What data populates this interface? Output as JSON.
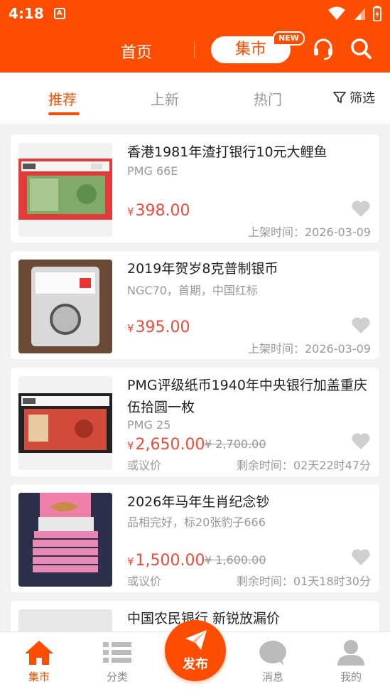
{
  "status": {
    "time": "4:18",
    "notification_glyph": "A"
  },
  "header": {
    "home_label": "首页",
    "market_label": "集市",
    "new_badge": "NEW"
  },
  "tabs": {
    "items": [
      "推荐",
      "上新",
      "热门"
    ],
    "active": "推荐",
    "filter_label": "筛选"
  },
  "listings": [
    {
      "title": "香港1981年渣打银行10元大鲤鱼",
      "subtitle": "PMG 66E",
      "currency": "¥",
      "price": "398.00",
      "meta": "上架时间：2026-03-09"
    },
    {
      "title": "2019年贺岁8克普制银币",
      "subtitle": "NGC70，首期，中国红标",
      "currency": "¥",
      "price": "395.00",
      "meta": "上架时间：2026-03-09"
    },
    {
      "title": "PMG评级纸币1940年中央银行加盖重庆伍拾圆一枚",
      "subtitle": "PMG 25",
      "currency": "¥",
      "price": "2,650.00",
      "old_price": "¥ 2,700.00",
      "negotiable": "或议价",
      "meta": "剩余时间：02天22时47分"
    },
    {
      "title": "2026年马年生肖纪念钞",
      "subtitle": "品相完好，标20张豹子666",
      "currency": "¥",
      "price": "1,500.00",
      "old_price": "¥ 1,600.00",
      "negotiable": "或议价",
      "meta": "剩余时间：01天18时30分"
    },
    {
      "title": "中国农民银行 新锐放漏价"
    }
  ],
  "tabbar": {
    "market": "集市",
    "category": "分类",
    "publish": "发布",
    "messages": "消息",
    "mine": "我的"
  },
  "colors": {
    "brand": "#ff4d00",
    "price": "#f04a3a"
  }
}
